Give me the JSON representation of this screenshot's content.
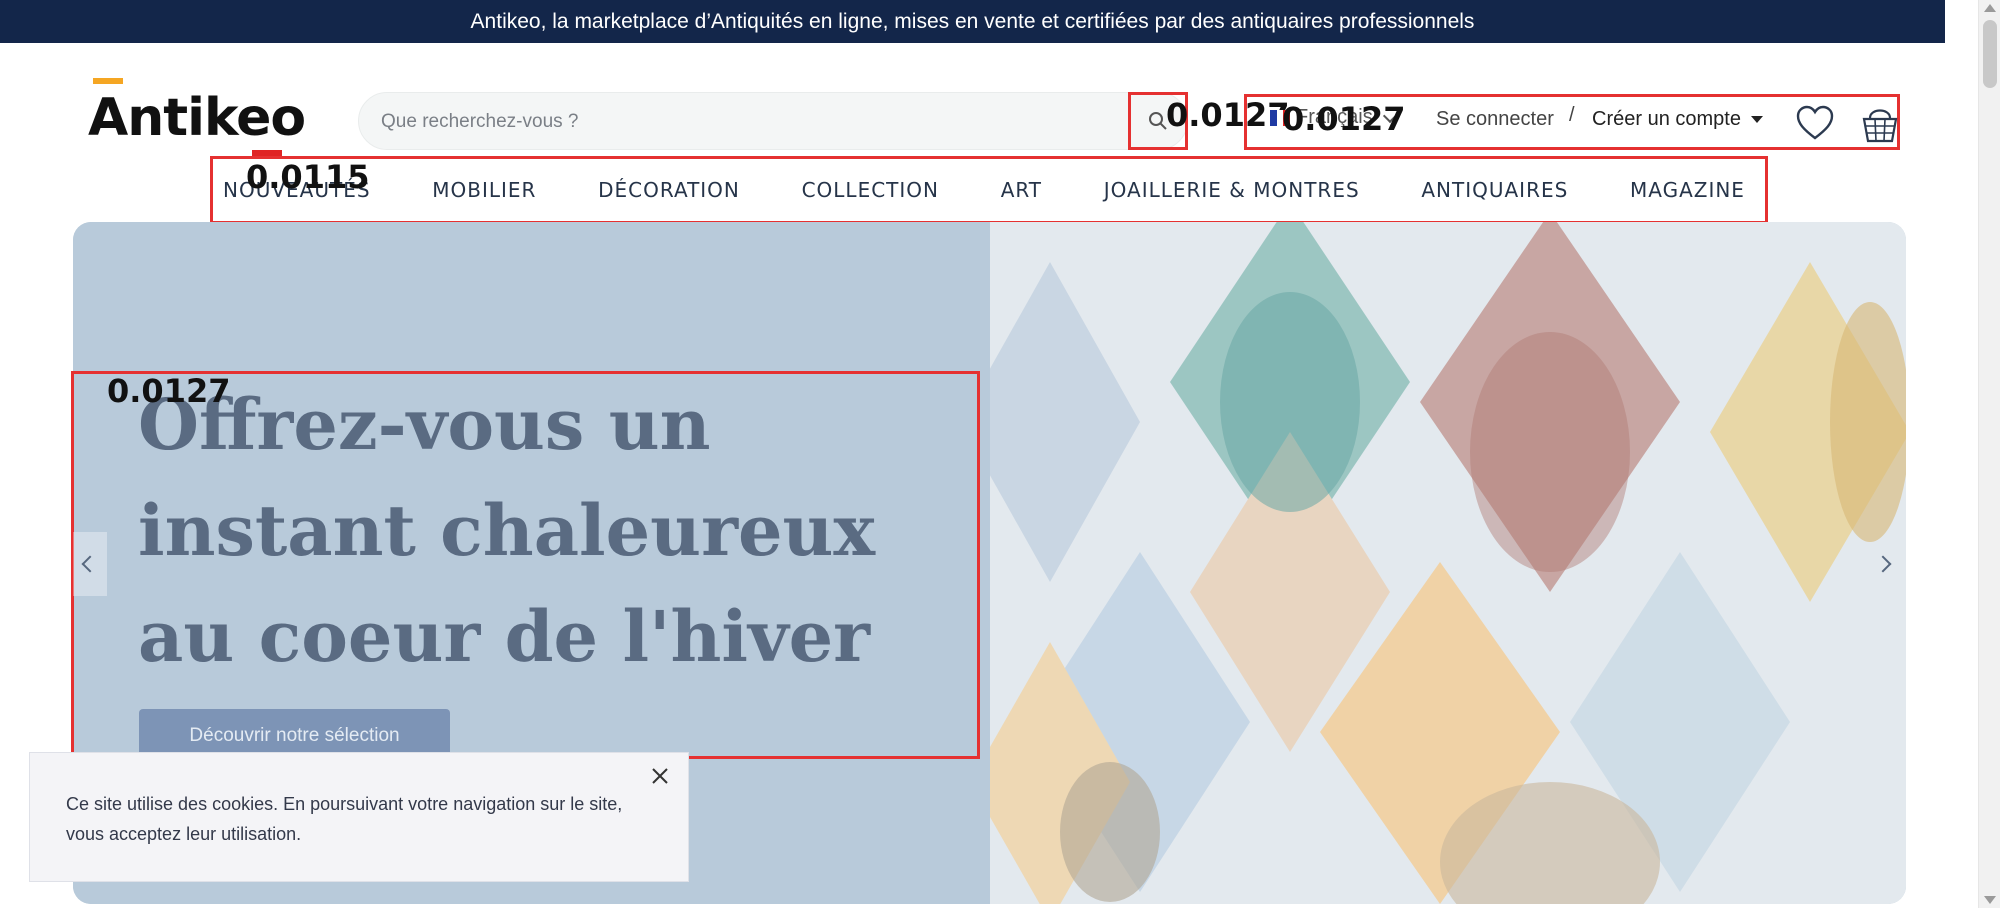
{
  "announcement": "Antikeo, la marketplace d’Antiquités en ligne, mises en vente et certifiées par des antiquaires professionnels",
  "logo": {
    "text": "Antikeo",
    "accent_color": "#f5a623",
    "dot_color": "#e02424"
  },
  "search": {
    "placeholder": "Que recherchez-vous ?",
    "value": "",
    "icon": "search-icon"
  },
  "language": {
    "label": "Français",
    "flag_colors": [
      "#1f3aa3",
      "#ffffff",
      "#e02424"
    ]
  },
  "account": {
    "login_label": "Se connecter",
    "separator": "/",
    "register_label": "Créer un compte"
  },
  "icons": {
    "wishlist": "heart-icon",
    "cart": "basket-icon"
  },
  "badges": {
    "search": "0.0127",
    "header": "0.0127",
    "nav": "0.0115",
    "hero": "0.0127"
  },
  "nav": {
    "items": [
      {
        "label": "NOUVEAUTÉS"
      },
      {
        "label": "MOBILIER"
      },
      {
        "label": "DÉCORATION"
      },
      {
        "label": "COLLECTION"
      },
      {
        "label": "ART"
      },
      {
        "label": "JOAILLERIE & MONTRES"
      },
      {
        "label": "ANTIQUAIRES"
      },
      {
        "label": "MAGAZINE"
      }
    ]
  },
  "hero": {
    "title": "Offrez-vous un instant chaleureux au coeur de l'hiver",
    "cta_label": "Découvrir notre sélection"
  },
  "cookie": {
    "text": "Ce site utilise des cookies. En poursuivant votre navigation sur le site, vous acceptez leur utilisation."
  },
  "colors": {
    "topbar": "#13264a",
    "highlight": "#e53131",
    "hero_bg": "#b8cada",
    "cta": "#7d94b6"
  }
}
